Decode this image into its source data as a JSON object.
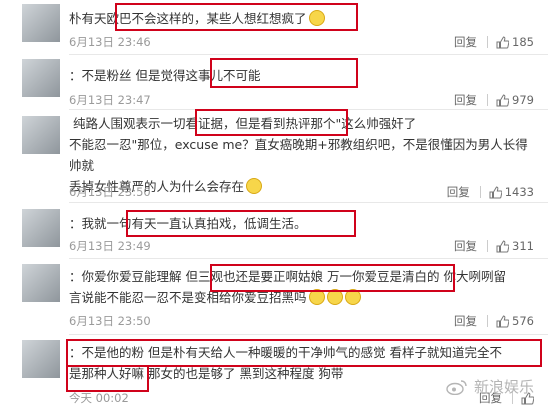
{
  "comments": [
    {
      "text": "朴有天欧巴不会这样的，某些人想红想疯了",
      "date": "6月13日 23:46",
      "reply": "回复",
      "likes": "185"
    },
    {
      "text_plain": "：不是粉丝 ",
      "text_hl": "但是觉得这事儿不可能",
      "date": "6月13日 23:47",
      "reply": "回复",
      "likes": "979"
    },
    {
      "text_hl": "纯路人围观表示一切看证据",
      "text_rest1": "，但是看到热评那个\"这么帅强奸了",
      "text_line2": "不能忍一忍\"那位，excuse me？直女癌晚期+邪教组织吧，不是很懂因为男人长得帅就",
      "text_line3": "丢掉女性尊严的人为什么会存在",
      "date": "6月13日 23:50",
      "reply": "回复",
      "likes": "1433"
    },
    {
      "text_hl": "：我就一句有天一直认真拍戏，低调生活。",
      "date": "6月13日 23:49",
      "reply": "回复",
      "likes": "311"
    },
    {
      "text_a": "：你爱你爱豆能理解",
      "text_hl": "但三观也还是要正啊姑娘 万一你爱豆是清白的",
      "text_b": "你大咧咧留",
      "text_line2": "言说能不能忍一忍不是变相给你爱豆招黑吗",
      "date": "6月13日 23:50",
      "reply": "回复",
      "likes": "576"
    },
    {
      "text_hl1": "：不是他的粉 但是朴有天给人一种暖暖的干净帅气的感觉 看样子就知道完全不",
      "text_hl2": "是那种人好嘛",
      "text_rest": " 那女的也是够了 黑到这种程度 狗带",
      "date": "今天 00:02",
      "reply": "回复"
    }
  ],
  "watermark": "新浪娱乐"
}
